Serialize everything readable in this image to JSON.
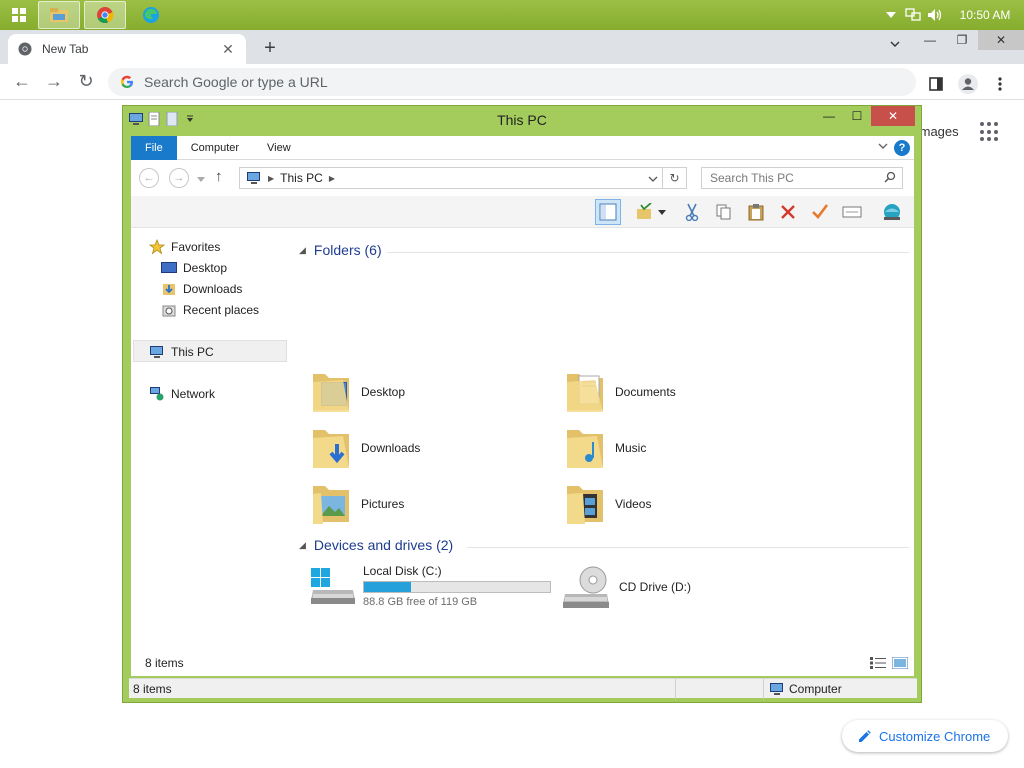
{
  "taskbar": {
    "time": "10:50 AM",
    "apps": [
      "file-explorer",
      "chrome",
      "edge"
    ]
  },
  "chrome": {
    "tab_title": "New Tab",
    "omnibox_placeholder": "Search Google or type a URL",
    "ntp_images": "Images",
    "customize_label": "Customize Chrome"
  },
  "explorer": {
    "title": "This PC",
    "ribbon_tabs": [
      "File",
      "Computer",
      "View"
    ],
    "address": "This PC",
    "search_placeholder": "Search This PC",
    "nav": {
      "favorites": "Favorites",
      "desktop": "Desktop",
      "downloads": "Downloads",
      "recent": "Recent places",
      "this_pc": "This PC",
      "network": "Network"
    },
    "folders_header": "Folders (6)",
    "folders": [
      "Desktop",
      "Documents",
      "Downloads",
      "Music",
      "Pictures",
      "Videos"
    ],
    "devices_header": "Devices and drives (2)",
    "drives": {
      "c_name": "Local Disk (C:)",
      "c_free": "88.8 GB free of 119 GB",
      "c_used_fraction": 0.254,
      "d_name": "CD Drive (D:)"
    },
    "items_count": "8 items",
    "status_items": "8 items",
    "status_location": "Computer"
  },
  "colors": {
    "accent_green": "#a3cc5c",
    "file_tab_blue": "#1979ca",
    "drive_bar": "#26a0da",
    "close_red": "#c7504a"
  }
}
